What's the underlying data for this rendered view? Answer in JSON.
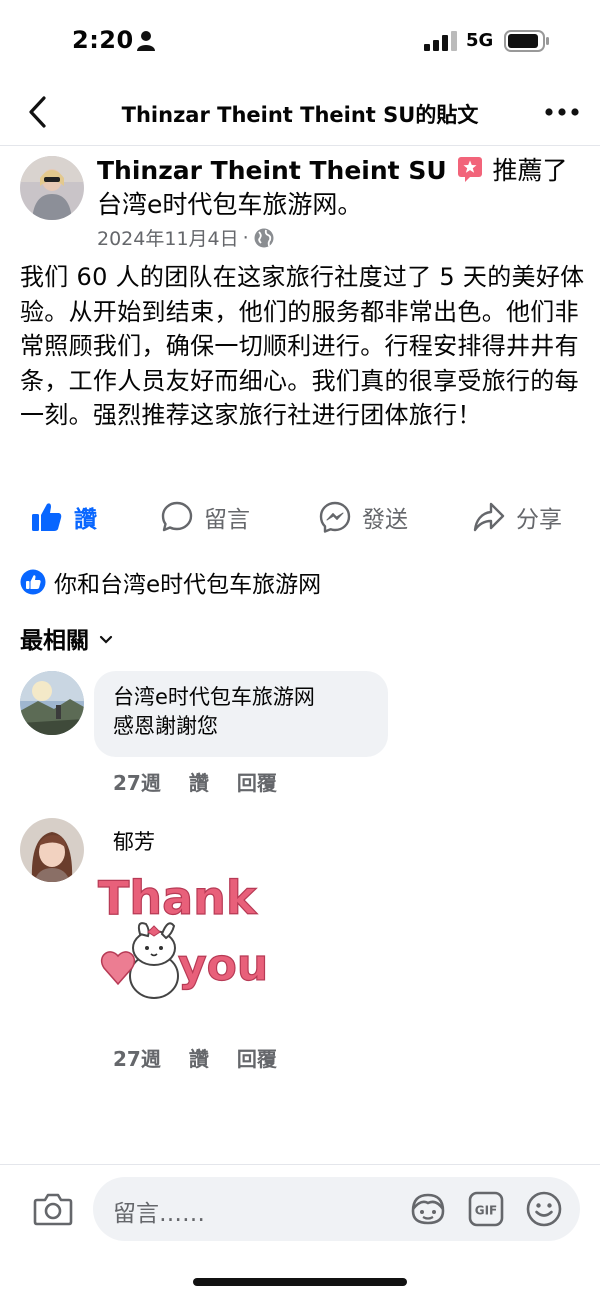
{
  "status_bar": {
    "time": "2:20",
    "network": "5G"
  },
  "nav": {
    "title": "Thinzar Theint Theint SU的貼文"
  },
  "post": {
    "author": "Thinzar Theint Theint SU",
    "action_text": "推薦了台湾e时代包车旅游网。",
    "date": "2024年11月4日",
    "dot": "·",
    "body": "我们 60 人的团队在这家旅行社度过了 5 天的美好体验。从开始到结束，他们的服务都非常出色。他们非常照顾我们，确保一切顺利进行。行程安排得井井有条，工作人员友好而细心。我们真的很享受旅行的每一刻。强烈推荐这家旅行社进行团体旅行！"
  },
  "actions": {
    "like": "讚",
    "comment": "留言",
    "send": "發送",
    "share": "分享"
  },
  "likes_summary": "你和台湾e时代包车旅游网",
  "sort_label": "最相關",
  "comments": [
    {
      "name": "台湾e时代包车旅游网",
      "text": "感恩謝謝您",
      "time": "27週",
      "like": "讚",
      "reply": "回覆"
    },
    {
      "name": "郁芳",
      "sticker_text": [
        "Thank",
        "you"
      ],
      "time": "27週",
      "like": "讚",
      "reply": "回覆"
    }
  ],
  "composer": {
    "placeholder": "留言……",
    "gif_label": "GIF"
  },
  "colors": {
    "accent": "#0866ff",
    "muted": "#65676b",
    "bubble": "#f0f2f5",
    "sticker_pink": "#e8607a"
  },
  "icons": [
    "person-icon",
    "signal-icon",
    "battery-icon",
    "back-chevron-icon",
    "more-dots-icon",
    "recommend-icon",
    "globe-icon",
    "like-thumb-icon",
    "comment-bubble-icon",
    "messenger-icon",
    "share-arrow-icon",
    "like-badge-icon",
    "chevron-down-icon",
    "camera-icon",
    "avatar-sticker-icon",
    "gif-icon",
    "emoji-icon"
  ]
}
